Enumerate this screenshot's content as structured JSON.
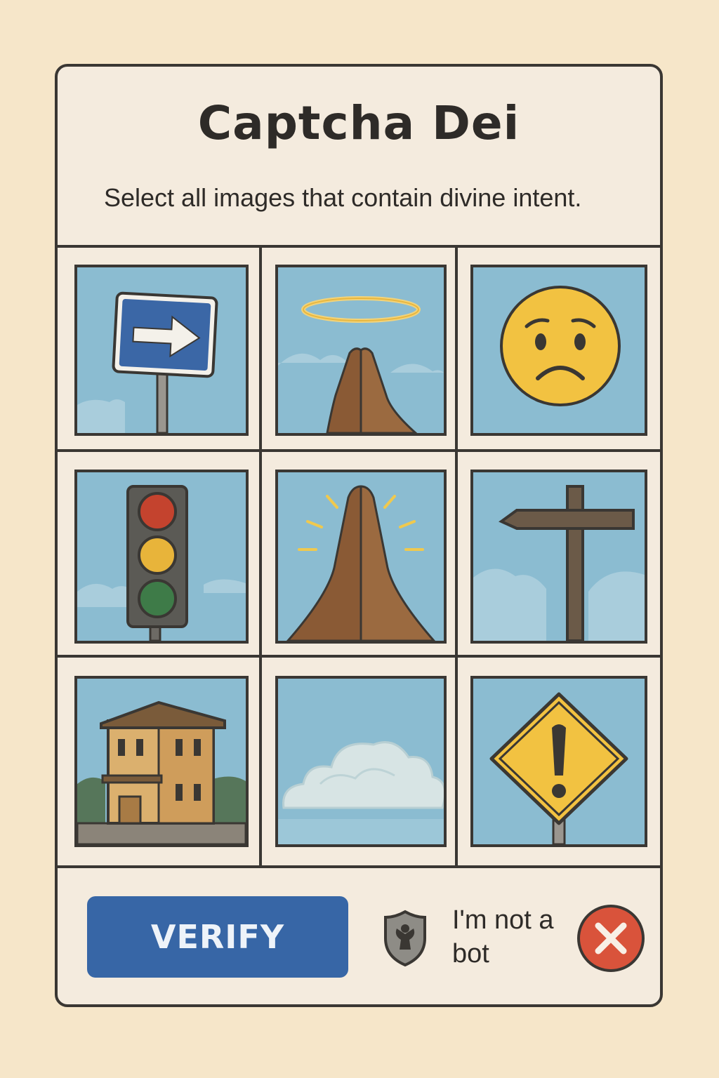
{
  "header": {
    "title": "Captcha Dei",
    "instruction": "Select all images that contain divine intent."
  },
  "grid": {
    "tiles": [
      {
        "icon": "direction-sign-icon",
        "selected": false
      },
      {
        "icon": "halo-praying-hands-icon",
        "selected": false
      },
      {
        "icon": "worried-face-icon",
        "selected": false
      },
      {
        "icon": "traffic-light-icon",
        "selected": false
      },
      {
        "icon": "glowing-praying-hands-icon",
        "selected": false
      },
      {
        "icon": "signpost-cross-icon",
        "selected": false
      },
      {
        "icon": "building-icon",
        "selected": false
      },
      {
        "icon": "cloud-icon",
        "selected": false
      },
      {
        "icon": "warning-sign-icon",
        "selected": false
      }
    ]
  },
  "footer": {
    "verify_label": "VERIFY",
    "bot_label": "I'm not a bot",
    "shield_icon": "angel-shield-icon",
    "dismiss_icon": "close-x-icon"
  },
  "colors": {
    "page_bg": "#f6e6c9",
    "card_bg": "#f4ebde",
    "line": "#3a3733",
    "sky": "#8bbcd1",
    "accent": "#3766a6",
    "ink": "#2e2b28",
    "error_red": "#d9533b"
  }
}
